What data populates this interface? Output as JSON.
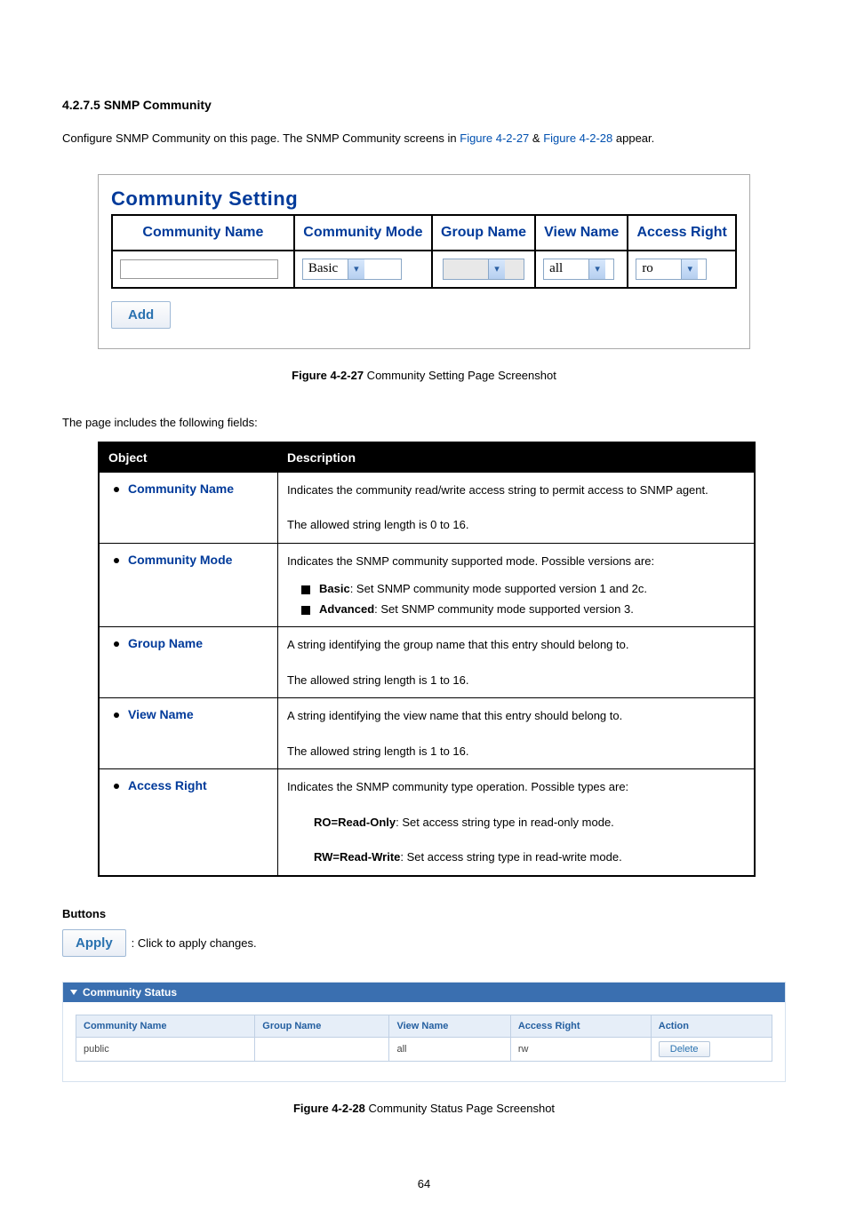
{
  "section": {
    "number": "4.2.7.5",
    "title": "SNMP Community"
  },
  "intro": {
    "text_before": "Configure SNMP Community on this page. The SNMP Community screens in ",
    "link1": "Figure 4-2-27",
    "amp": " & ",
    "link2": "Figure 4-2-28",
    "text_after": " appear."
  },
  "community_setting": {
    "panel_title": "Community Setting",
    "headers": {
      "name": "Community Name",
      "mode": "Community Mode",
      "group": "Group Name",
      "view": "View Name",
      "access": "Access Right"
    },
    "values": {
      "name": "",
      "mode": "Basic",
      "group": "",
      "view": "all",
      "access": "ro"
    },
    "add_button": "Add"
  },
  "figcap1_bold": "Figure 4-2-27",
  "figcap1_rest": " Community Setting Page Screenshot",
  "fields_lead": "The page includes the following fields:",
  "objtable": {
    "head_object": "Object",
    "head_desc": "Description",
    "rows": [
      {
        "object": "Community Name",
        "lines": [
          "Indicates the community read/write access string to permit access to SNMP agent.",
          "The allowed string length is 0 to 16."
        ]
      },
      {
        "object": "Community Mode",
        "intro": "Indicates the SNMP community supported mode. Possible versions are:",
        "items": [
          {
            "bold": "Basic",
            "rest": ": Set SNMP community mode supported version 1 and 2c."
          },
          {
            "bold": "Advanced",
            "rest": ": Set SNMP community mode supported version 3."
          }
        ]
      },
      {
        "object": "Group Name",
        "lines": [
          "A string identifying the group name that this entry should belong to.",
          "The allowed string length is 1 to 16."
        ]
      },
      {
        "object": "View Name",
        "lines": [
          "A string identifying the view name that this entry should belong to.",
          "The allowed string length is 1 to 16."
        ]
      },
      {
        "object": "Access Right",
        "intro": "Indicates the SNMP community type operation. Possible types are:",
        "items": [
          {
            "bold": "RO=Read-Only",
            "rest": ": Set access string type in read-only mode."
          },
          {
            "bold": "RW=Read-Write",
            "rest": ": Set access string type in read-write mode."
          }
        ],
        "deep": true
      }
    ]
  },
  "buttons_section": {
    "heading": "Buttons",
    "apply_label": "Apply",
    "apply_desc": ": Click to apply changes."
  },
  "status_panel": {
    "bar_title": "Community Status",
    "headers": {
      "name": "Community Name",
      "group": "Group Name",
      "view": "View Name",
      "access": "Access Right",
      "action": "Action"
    },
    "row": {
      "name": "public",
      "group": "",
      "view": "all",
      "access": "rw",
      "action": "Delete"
    }
  },
  "figcap2_bold": "Figure 4-2-28",
  "figcap2_rest": " Community Status Page Screenshot",
  "page_number": "64"
}
